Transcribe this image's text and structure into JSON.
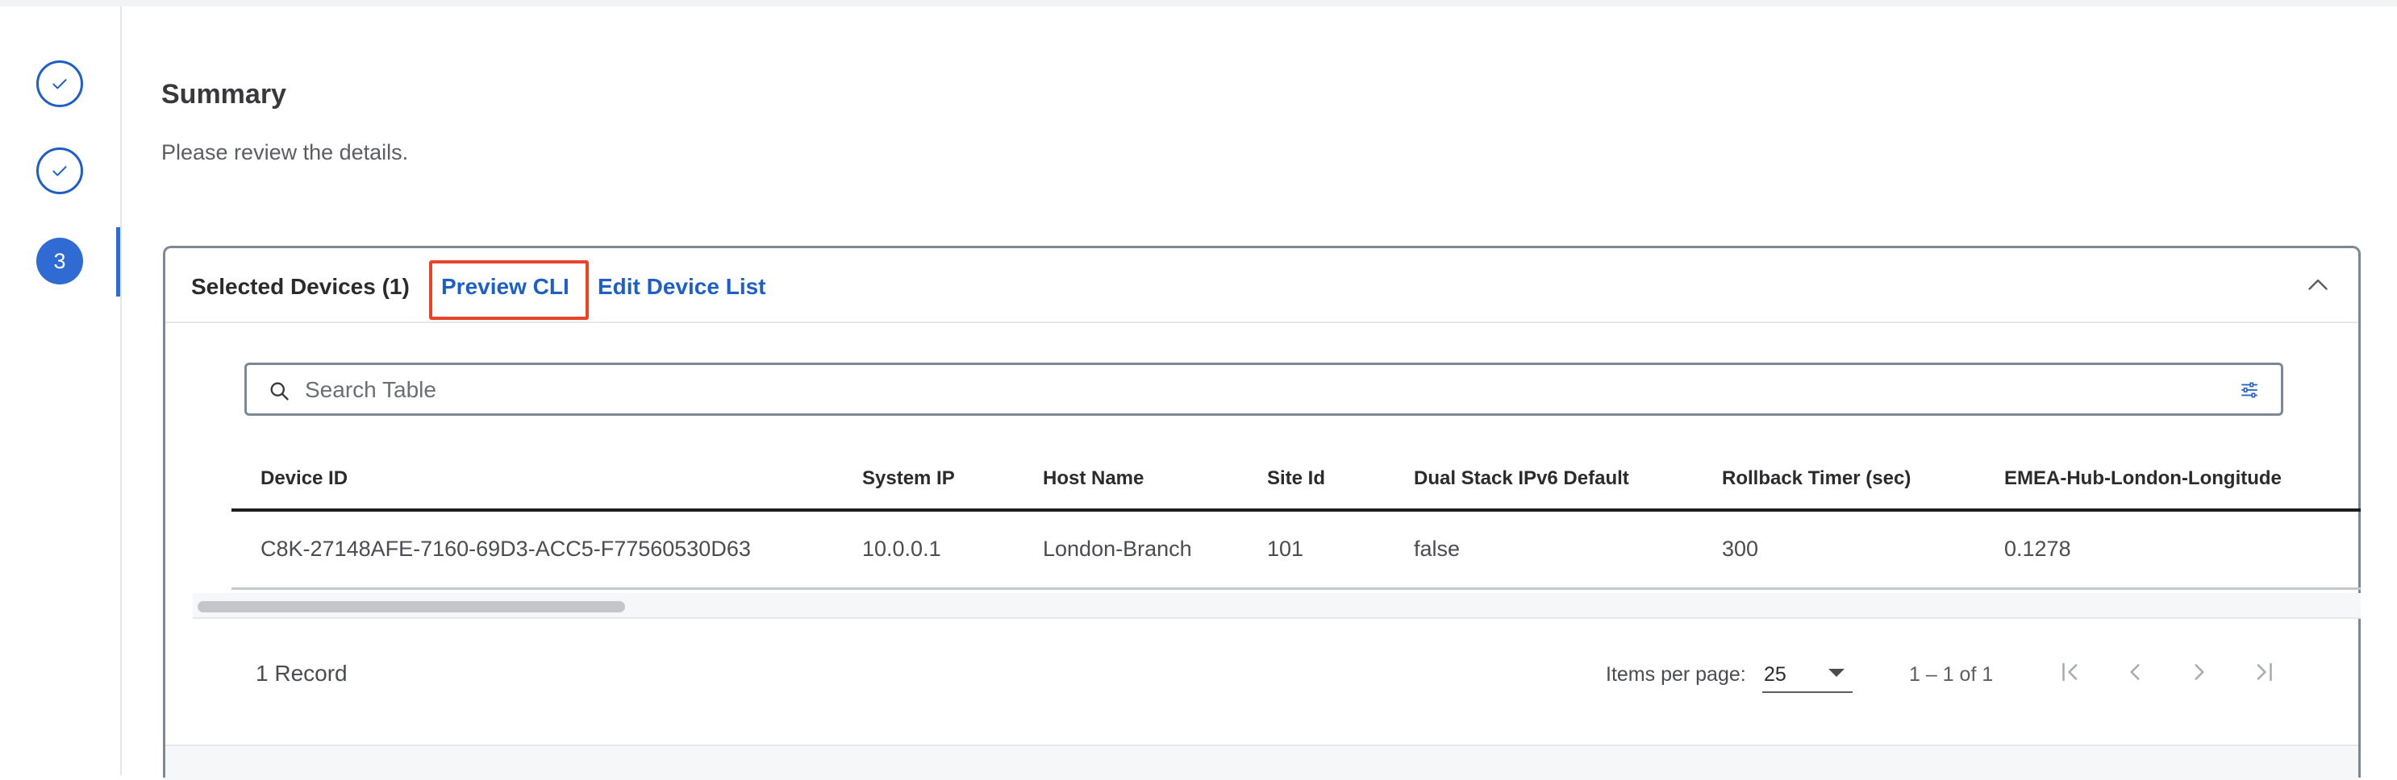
{
  "steps": [
    {
      "number": "1",
      "state": "done",
      "icon": "check-icon"
    },
    {
      "number": "2",
      "state": "done",
      "icon": "check-icon"
    },
    {
      "number": "3",
      "state": "active"
    }
  ],
  "page": {
    "title": "Summary",
    "subtitle": "Please review the details."
  },
  "card": {
    "title": "Selected Devices (1)",
    "preview_label": "Preview CLI",
    "edit_label": "Edit Device List",
    "collapse_icon": "chevron-up-icon"
  },
  "search": {
    "placeholder": "Search Table",
    "icon": "search-icon",
    "filter_icon": "filter-settings-icon"
  },
  "table": {
    "columns": [
      "Device ID",
      "System IP",
      "Host Name",
      "Site Id",
      "Dual Stack IPv6 Default",
      "Rollback Timer (sec)",
      "EMEA-Hub-London-Longitude"
    ],
    "rows": [
      [
        "C8K-27148AFE-7160-69D3-ACC5-F77560530D63",
        "10.0.0.1",
        "London-Branch",
        "101",
        "false",
        "300",
        "0.1278"
      ]
    ]
  },
  "footer": {
    "records": "1 Record",
    "items_per_page_label": "Items per page:",
    "items_per_page_value": "25",
    "range": "1 – 1 of 1"
  },
  "colors": {
    "accent": "#2f6bd3",
    "link": "#1f5fc5",
    "highlight": "#e8442a"
  }
}
